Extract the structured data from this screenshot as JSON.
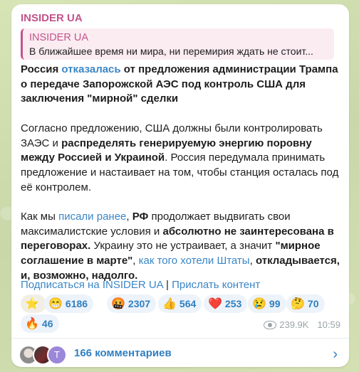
{
  "message": {
    "sender": "INSIDER UA",
    "reply": {
      "name": "INSIDER UA",
      "text": "В ближайшее время ни мира, ни перемирия ждать не стоит..."
    },
    "headline": {
      "p1": "Россия ",
      "link": "отказалась",
      "p2": " от предложения администрации Трампа о передаче Запорожской АЭС под контроль США для заключения \"мирной\" сделки"
    },
    "para2": {
      "p1": "Согласно предложению, США должны были контролировать ЗАЭС и ",
      "b1": "распределять генерируемую энергию поровну между Россией и Украиной",
      "p2": ". Россия передумала принимать предложение и настаивает на том, чтобы станция осталась под её контролем."
    },
    "para3": {
      "p1": "Как мы ",
      "link1": "писали ранее",
      "p2": ", ",
      "b1": "РФ",
      "p3": " продолжает выдвигать свои максималистские условия и ",
      "b2": "абсолютно не заинтересована в переговорах.",
      "p4": " Украину это не устраивает, а значит ",
      "b3": "\"мирное соглашение в марте\"",
      "p5": ", ",
      "link2": "как того хотели Штаты",
      "p6": ", ",
      "b4": "откладывается, и, возможно, надолго."
    },
    "footer": {
      "subscribe": "Подписаться на INSIDER UA",
      "separator": " | ",
      "send": "Прислать контент"
    },
    "reactions": [
      {
        "icon": "⭐",
        "count": ""
      },
      {
        "icon": "😁",
        "count": "6186"
      },
      {
        "icon": "🤬",
        "count": "2307"
      },
      {
        "icon": "👍",
        "count": "564"
      },
      {
        "icon": "❤️",
        "count": "253"
      },
      {
        "icon": "😢",
        "count": "99"
      },
      {
        "icon": "🤔",
        "count": "70"
      },
      {
        "icon": "🔥",
        "count": "46"
      }
    ],
    "views": "239.9K",
    "time": "10:59"
  },
  "comments": {
    "avatar3_letter": "T",
    "label": "166 комментариев",
    "chevron": "›"
  }
}
